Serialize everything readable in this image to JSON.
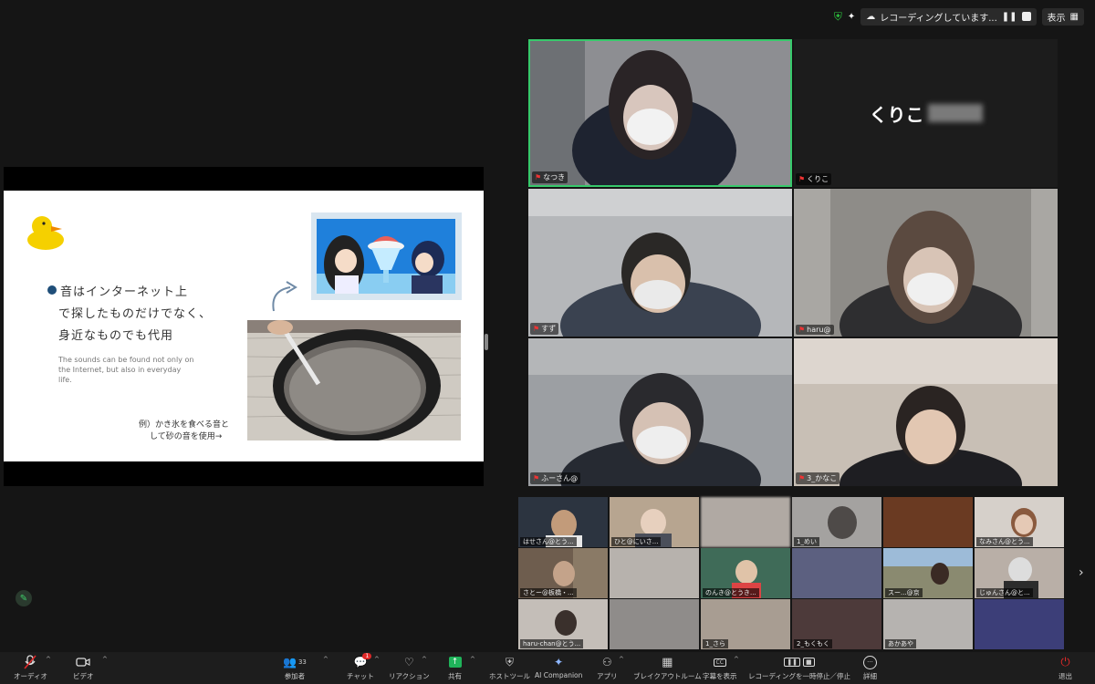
{
  "top_status": {
    "recording_text": "レコーディングしています...",
    "view_label": "表示"
  },
  "slide": {
    "line1": "音はインターネット上",
    "line2": "で探したものだけでなく、",
    "line3": "身近なものでも代用",
    "english": "The sounds can be found not only on the Internet, but also in everyday life.",
    "example1": "例）かき氷を食べる音と",
    "example2": "して砂の音を使用→"
  },
  "gallery": {
    "big_name": "くりこ",
    "tiles": [
      {
        "name": "なつき"
      },
      {
        "name": "くりこ"
      },
      {
        "name": "すず"
      },
      {
        "name": "haru@"
      },
      {
        "name": "ふーさん@"
      },
      {
        "name": "3_かなこ"
      }
    ],
    "thumbs": [
      {
        "name": "はせさん@とう..."
      },
      {
        "name": "ひと@にいさ..."
      },
      {
        "name": ""
      },
      {
        "name": "1_めい"
      },
      {
        "name": ""
      },
      {
        "name": "なみさん@とう..."
      },
      {
        "name": "さとー@板橋・..."
      },
      {
        "name": ""
      },
      {
        "name": "のんき@とうき..."
      },
      {
        "name": ""
      },
      {
        "name": "スー...@京"
      },
      {
        "name": "じゅんさん@と..."
      },
      {
        "name": "haru-chan@とう..."
      },
      {
        "name": ""
      },
      {
        "name": "1_さら"
      },
      {
        "name": "2_もくもく"
      },
      {
        "name": "あかあや"
      },
      {
        "name": ""
      }
    ]
  },
  "toolbar": {
    "audio": "オーディオ",
    "video": "ビデオ",
    "participants": "参加者",
    "participants_count": "33",
    "chat": "チャット",
    "chat_badge": "1",
    "reactions": "リアクション",
    "share": "共有",
    "host_tools": "ホストツール",
    "ai_companion": "AI Companion",
    "apps": "アプリ",
    "breakout": "ブレイクアウトルーム",
    "captions": "字幕を表示",
    "recording": "レコーディングを一時停止／停止",
    "more": "詳細",
    "leave": "退出"
  },
  "colors": {
    "active_speaker": "#37c96b",
    "leave": "#e02828",
    "share_green": "#1fb35a"
  }
}
